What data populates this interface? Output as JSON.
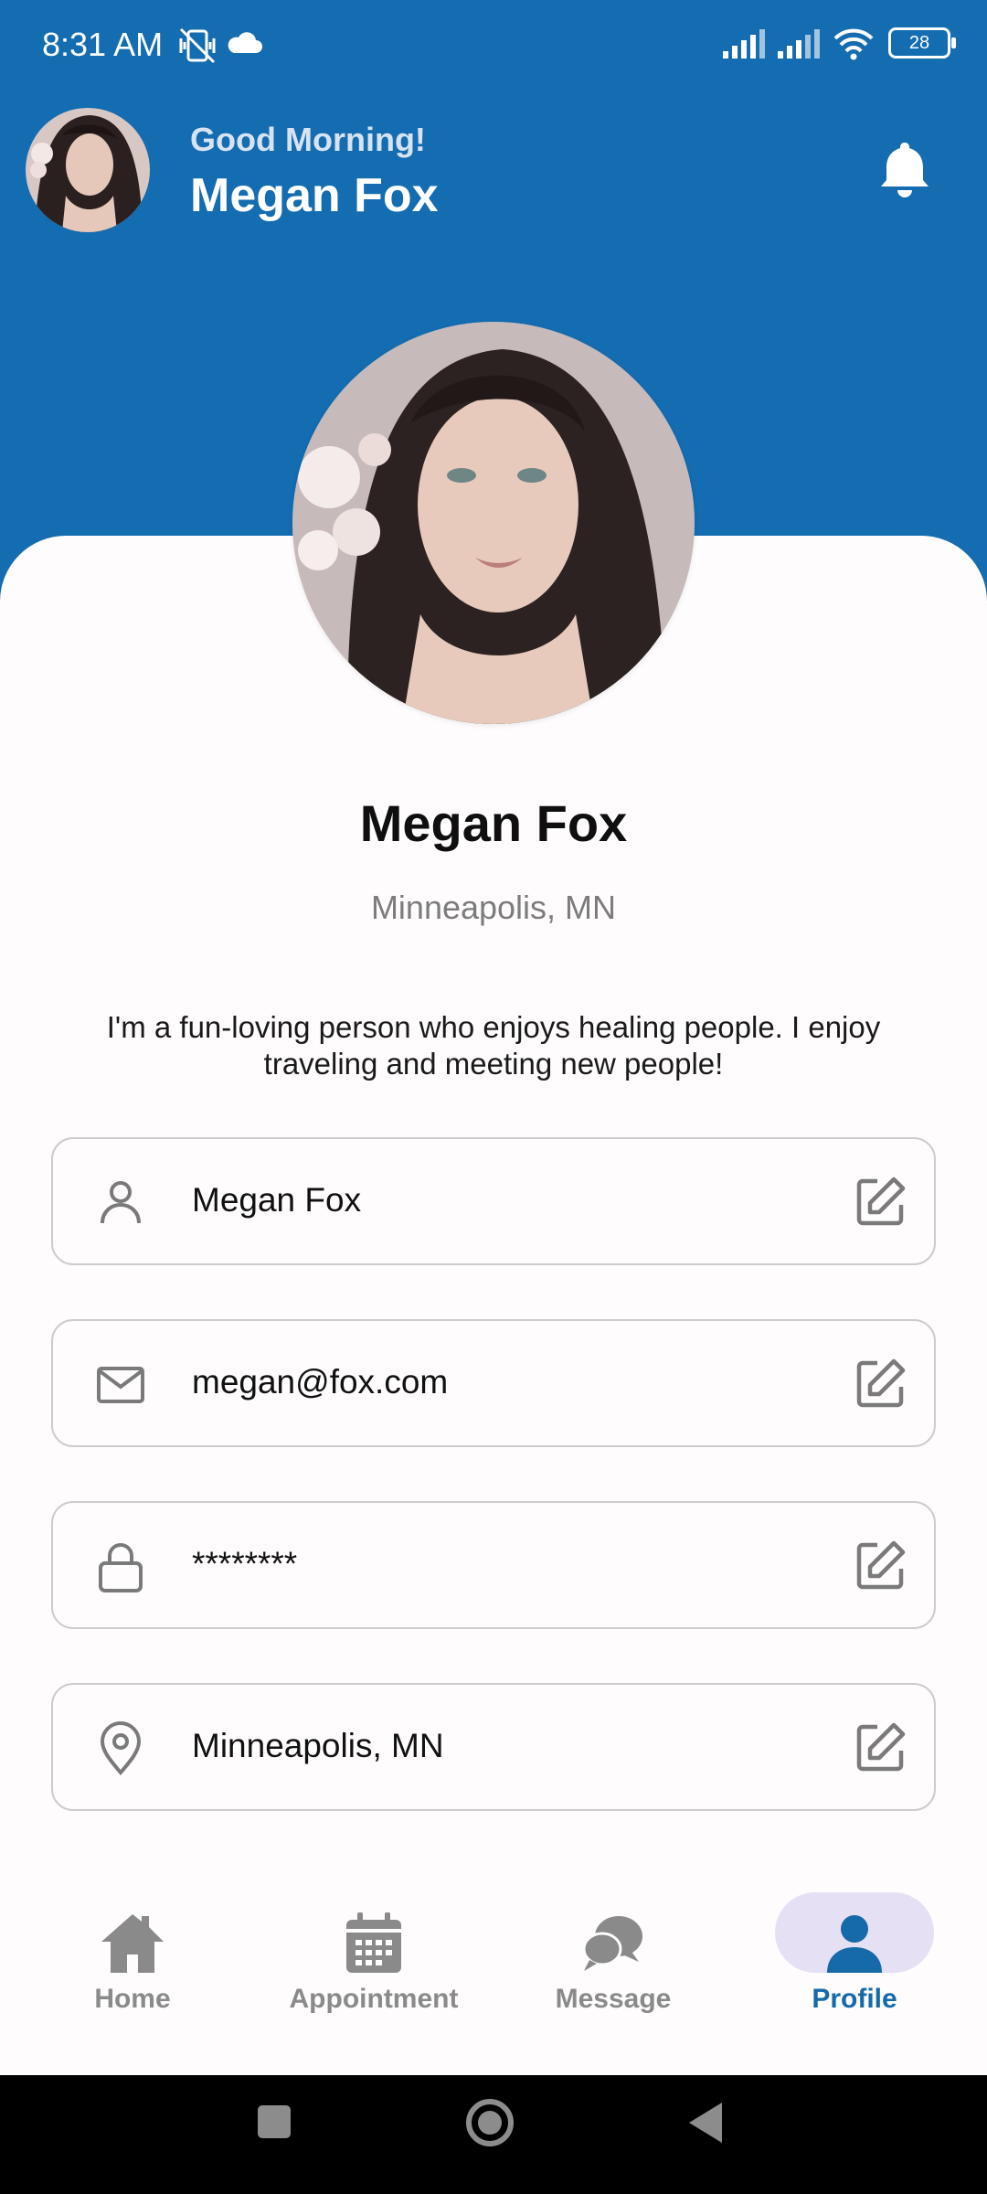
{
  "status_bar": {
    "time": "8:31 AM",
    "battery": "28",
    "icons": [
      "vibrate-off-icon",
      "cloud-icon",
      "signal-icon",
      "signal-icon",
      "wifi-icon",
      "battery-icon"
    ]
  },
  "header": {
    "greeting": "Good Morning!",
    "user_name": "Megan Fox",
    "notification_icon": "bell-icon"
  },
  "profile": {
    "name": "Megan Fox",
    "location": "Minneapolis, MN",
    "bio": "I'm a fun-loving person who enjoys healing people. I enjoy traveling and meeting new people!"
  },
  "fields": [
    {
      "icon": "person-icon",
      "value": "Megan Fox"
    },
    {
      "icon": "mail-icon",
      "value": "megan@fox.com"
    },
    {
      "icon": "lock-icon",
      "value": "********"
    },
    {
      "icon": "location-pin-icon",
      "value": "Minneapolis, MN"
    }
  ],
  "bottom_nav": {
    "items": [
      {
        "label": "Home",
        "icon": "home-icon",
        "active": false
      },
      {
        "label": "Appointment",
        "icon": "calendar-icon",
        "active": false
      },
      {
        "label": "Message",
        "icon": "chat-icon",
        "active": false
      },
      {
        "label": "Profile",
        "icon": "person-icon",
        "active": true
      }
    ]
  },
  "colors": {
    "primary": "#146cb1",
    "active_pill": "#e6e0f5",
    "active_label": "#176aa9",
    "inactive": "#8a8a8a"
  }
}
